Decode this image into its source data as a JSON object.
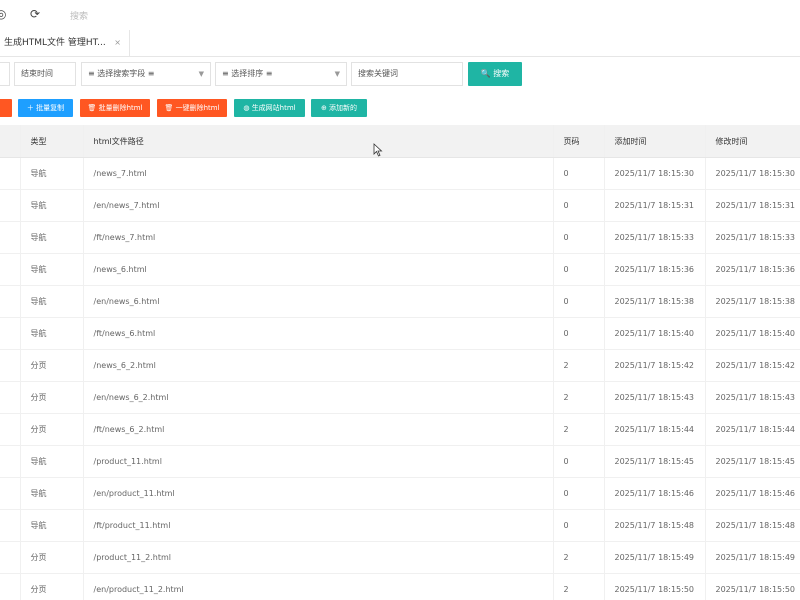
{
  "topbar": {
    "icon_left": "◎",
    "icon_refresh": "⟳",
    "search_label": "搜索"
  },
  "tab": {
    "label": "生成HTML文件 管理HT...",
    "close": "×"
  },
  "filters": {
    "end_time": "结束时间",
    "search_field": "≡ 选择搜索字段 ≡",
    "sort": "≡ 选择排序 ≡",
    "keyword_placeholder": "搜索关键词",
    "search_button": "搜索"
  },
  "actions": {
    "batch_copy": "批量复制",
    "batch_delete_html": "批量删除html",
    "one_click_delete_html": "一键删除html",
    "generate_site_html": "生成网站html",
    "add_new": "添加新的"
  },
  "table": {
    "headers": [
      "类型",
      "html文件路径",
      "页码",
      "添加时间",
      "修改时间"
    ],
    "rows": [
      [
        "导航",
        "/news_7.html",
        "0",
        "2025/11/7 18:15:30",
        "2025/11/7 18:15:30"
      ],
      [
        "导航",
        "/en/news_7.html",
        "0",
        "2025/11/7 18:15:31",
        "2025/11/7 18:15:31"
      ],
      [
        "导航",
        "/ft/news_7.html",
        "0",
        "2025/11/7 18:15:33",
        "2025/11/7 18:15:33"
      ],
      [
        "导航",
        "/news_6.html",
        "0",
        "2025/11/7 18:15:36",
        "2025/11/7 18:15:36"
      ],
      [
        "导航",
        "/en/news_6.html",
        "0",
        "2025/11/7 18:15:38",
        "2025/11/7 18:15:38"
      ],
      [
        "导航",
        "/ft/news_6.html",
        "0",
        "2025/11/7 18:15:40",
        "2025/11/7 18:15:40"
      ],
      [
        "分页",
        "/news_6_2.html",
        "2",
        "2025/11/7 18:15:42",
        "2025/11/7 18:15:42"
      ],
      [
        "分页",
        "/en/news_6_2.html",
        "2",
        "2025/11/7 18:15:43",
        "2025/11/7 18:15:43"
      ],
      [
        "分页",
        "/ft/news_6_2.html",
        "2",
        "2025/11/7 18:15:44",
        "2025/11/7 18:15:44"
      ],
      [
        "导航",
        "/product_11.html",
        "0",
        "2025/11/7 18:15:45",
        "2025/11/7 18:15:45"
      ],
      [
        "导航",
        "/en/product_11.html",
        "0",
        "2025/11/7 18:15:46",
        "2025/11/7 18:15:46"
      ],
      [
        "导航",
        "/ft/product_11.html",
        "0",
        "2025/11/7 18:15:48",
        "2025/11/7 18:15:48"
      ],
      [
        "分页",
        "/product_11_2.html",
        "2",
        "2025/11/7 18:15:49",
        "2025/11/7 18:15:49"
      ],
      [
        "分页",
        "/en/product_11_2.html",
        "2",
        "2025/11/7 18:15:50",
        "2025/11/7 18:15:50"
      ]
    ]
  },
  "colors": {
    "teal": "#1fb5a4",
    "blue": "#1e9fff",
    "orange": "#ff5722",
    "header_bg": "#f2f2f2"
  }
}
